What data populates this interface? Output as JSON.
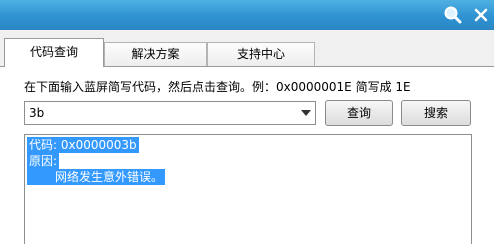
{
  "titlebar": {
    "search_icon": "magnifier-icon",
    "close_icon": "close-icon"
  },
  "tabs": [
    {
      "label": "代码查询",
      "active": true
    },
    {
      "label": "解决方案",
      "active": false
    },
    {
      "label": "支持中心",
      "active": false
    }
  ],
  "query": {
    "hint": "在下面输入蓝屏简写代码，然后点击查询。例：0x0000001E 简写成 1E",
    "code_value": "3b",
    "query_button": "查询",
    "search_button": "搜索"
  },
  "result": {
    "code_line": "代码: 0x0000003b",
    "reason_label": "原因:",
    "reason_text": "网络发生意外错误。"
  },
  "colors": {
    "titlebar": "#2f93d2",
    "selection": "#3399ff"
  }
}
